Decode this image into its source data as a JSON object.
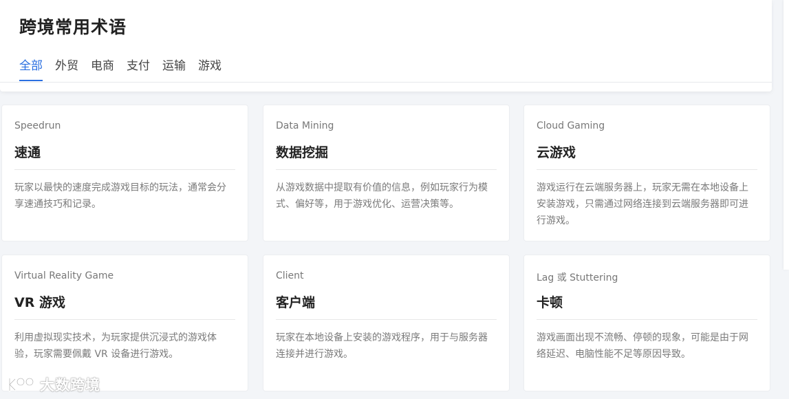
{
  "page": {
    "title": "跨境常用术语"
  },
  "tabs": [
    {
      "label": "全部",
      "active": true
    },
    {
      "label": "外贸",
      "active": false
    },
    {
      "label": "电商",
      "active": false
    },
    {
      "label": "支付",
      "active": false
    },
    {
      "label": "运输",
      "active": false
    },
    {
      "label": "游戏",
      "active": false
    }
  ],
  "cards": [
    {
      "en": "Speedrun",
      "zh": "速通",
      "desc": "玩家以最快的速度完成游戏目标的玩法，通常会分享速通技巧和记录。"
    },
    {
      "en": "Data Mining",
      "zh": "数据挖掘",
      "desc": "从游戏数据中提取有价值的信息，例如玩家行为模式、偏好等，用于游戏优化、运营决策等。"
    },
    {
      "en": "Cloud Gaming",
      "zh": "云游戏",
      "desc": "游戏运行在云端服务器上，玩家无需在本地设备上安装游戏，只需通过网络连接到云端服务器即可进行游戏。"
    },
    {
      "en": "Virtual Reality Game",
      "zh": "VR 游戏",
      "desc": "利用虚拟现实技术，为玩家提供沉浸式的游戏体验，玩家需要佩戴 VR 设备进行游戏。"
    },
    {
      "en": "Client",
      "zh": "客户端",
      "desc": "玩家在本地设备上安装的游戏程序，用于与服务器连接并进行游戏。"
    },
    {
      "en": "Lag 或 Stuttering",
      "zh": "卡顿",
      "desc": "游戏画面出现不流畅、停顿的现象，可能是由于网络延迟、电脑性能不足等原因导致。"
    }
  ],
  "watermark": {
    "text": "大数跨境"
  },
  "colors": {
    "accent": "#2a6fe0",
    "background": "#f3f5f8"
  }
}
